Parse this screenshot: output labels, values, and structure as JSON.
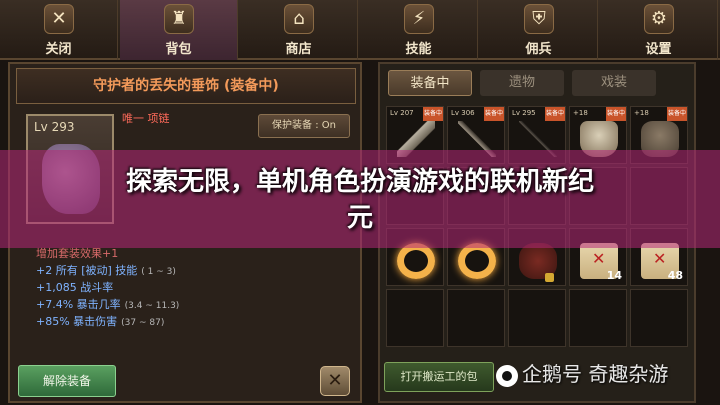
{
  "nav": [
    {
      "icon": "✕",
      "icon_name": "close-icon",
      "label": "关闭"
    },
    {
      "icon": "♜",
      "icon_name": "backpack-icon",
      "label": "背包"
    },
    {
      "icon": "⌂",
      "icon_name": "shop-icon",
      "label": "商店"
    },
    {
      "icon": "⚡",
      "icon_name": "skill-icon",
      "label": "技能"
    },
    {
      "icon": "⛨",
      "icon_name": "mercenary-icon",
      "label": "佣兵"
    },
    {
      "icon": "⚙",
      "icon_name": "gear-icon",
      "label": "设置"
    }
  ],
  "item": {
    "title": "守护者的丢失的垂饰 (装备中)",
    "level": "Lv 293",
    "unique_tag": "唯一 项链",
    "protect_label": "保护装备 : On",
    "set_bonus_head": "增加套装效果+1",
    "stats": [
      {
        "text": "+2 所有 [被动] 技能",
        "range": "( 1 ~ 3)"
      },
      {
        "text": "+1,085 战斗率",
        "range": ""
      },
      {
        "text": "+7.4% 暴击几率",
        "range": "(3.4 ~ 11.3)"
      },
      {
        "text": "+85% 暴击伤害",
        "range": "(37 ~ 87)"
      }
    ],
    "unequip_label": "解除装备",
    "close_label": "✕"
  },
  "inventory": {
    "tabs": [
      "装备中",
      "遗物",
      "戏装"
    ],
    "active_tab": 0,
    "cells": [
      {
        "lv": "Lv 207",
        "badge": "装备中",
        "art": "gun",
        "qty": ""
      },
      {
        "lv": "Lv 306",
        "badge": "装备中",
        "art": "sword",
        "qty": ""
      },
      {
        "lv": "Lv 295",
        "badge": "装备中",
        "art": "spear",
        "qty": ""
      },
      {
        "lv": "+18",
        "badge": "装备中",
        "art": "robe",
        "qty": ""
      },
      {
        "lv": "+18",
        "badge": "装备中",
        "art": "armor",
        "qty": ""
      },
      {
        "lv": "",
        "badge": "",
        "art": "",
        "qty": ""
      },
      {
        "lv": "",
        "badge": "",
        "art": "",
        "qty": ""
      },
      {
        "lv": "",
        "badge": "",
        "art": "",
        "qty": ""
      },
      {
        "lv": "",
        "badge": "",
        "art": "",
        "qty": ""
      },
      {
        "lv": "",
        "badge": "",
        "art": "",
        "qty": ""
      },
      {
        "lv": "",
        "badge": "",
        "art": "ring",
        "qty": ""
      },
      {
        "lv": "",
        "badge": "",
        "art": "ring",
        "qty": ""
      },
      {
        "lv": "",
        "badge": "",
        "art": "beast",
        "qty": "",
        "locked": true
      },
      {
        "lv": "",
        "badge": "",
        "art": "scroll",
        "qty": "14"
      },
      {
        "lv": "",
        "badge": "",
        "art": "scroll",
        "qty": "48"
      },
      {
        "lv": "",
        "badge": "",
        "art": "",
        "qty": ""
      },
      {
        "lv": "",
        "badge": "",
        "art": "",
        "qty": ""
      },
      {
        "lv": "",
        "badge": "",
        "art": "",
        "qty": ""
      },
      {
        "lv": "",
        "badge": "",
        "art": "",
        "qty": ""
      },
      {
        "lv": "",
        "badge": "",
        "art": "",
        "qty": ""
      }
    ],
    "open_transport_label": "打开搬运工的包"
  },
  "banner": {
    "title_line1": "探索无限，单机角色扮演游戏的联机新纪",
    "title_line2": "元"
  },
  "watermark": "企鹅号 奇趣杂游"
}
